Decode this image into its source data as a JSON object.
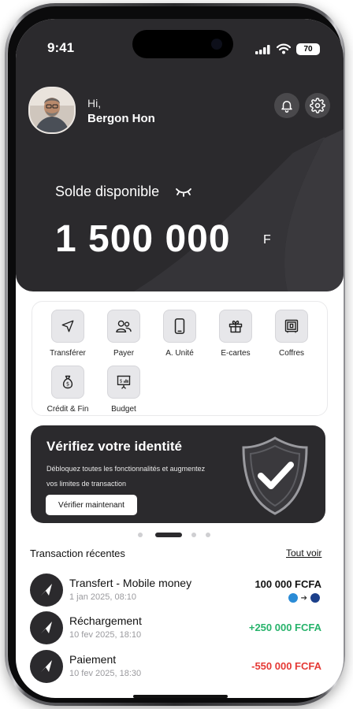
{
  "status_bar": {
    "time": "9:41",
    "battery": "70"
  },
  "user": {
    "greeting": "Hi,",
    "name": "Bergon Hon"
  },
  "balance": {
    "label": "Solde disponible",
    "amount": "1 500 000",
    "currency": "F"
  },
  "services": [
    {
      "label": "Transférer",
      "icon": "send-icon"
    },
    {
      "label": "Payer",
      "icon": "users-icon"
    },
    {
      "label": "A. Unité",
      "icon": "phone-icon"
    },
    {
      "label": "E-cartes",
      "icon": "gift-icon"
    },
    {
      "label": "Coffres",
      "icon": "safe-icon"
    },
    {
      "label": "Crédit & Fin",
      "icon": "money-bag-icon"
    },
    {
      "label": "Budget",
      "icon": "presentation-chart-icon"
    }
  ],
  "promo": {
    "title": "Vérifiez votre identité",
    "description": "Débloquez toutes les fonctionnalités et augmentez vos limites de transaction",
    "button": "Vérifier maintenant"
  },
  "carousel": {
    "count": 4,
    "active": 1
  },
  "transactions": {
    "title": "Transaction récentes",
    "see_all": "Tout voir",
    "items": [
      {
        "name": "Transfert - Mobile money",
        "date": "1 jan 2025, 08:10",
        "amount": "100 000 FCFA",
        "color": "#111111"
      },
      {
        "name": "Réchargement",
        "date": "10 fev 2025, 18:10",
        "amount": "+250 000 FCFA",
        "color": "#27b36b"
      },
      {
        "name": "Paiement",
        "date": "10 fev 2025, 18:30",
        "amount": "-550 000 FCFA",
        "color": "#e53935"
      }
    ]
  },
  "colors": {
    "header_bg": "#2b2a2d",
    "positive": "#27b36b",
    "negative": "#e53935"
  }
}
